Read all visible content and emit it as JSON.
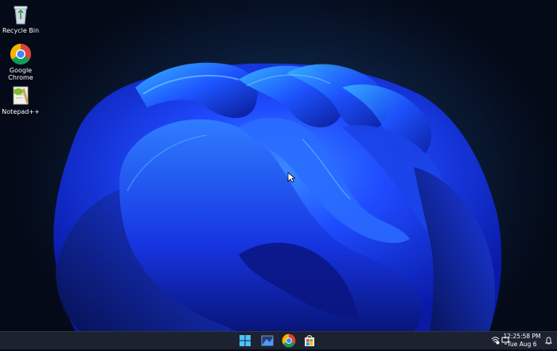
{
  "desktop": {
    "icons": [
      {
        "label": "Recycle Bin",
        "icon": "recycle-bin-icon"
      },
      {
        "label": "Google Chrome",
        "line1": "Google",
        "line2": "Chrome",
        "icon": "chrome-icon"
      },
      {
        "label": "Notepad++",
        "icon": "notepad-plus-plus-icon"
      }
    ]
  },
  "taskbar": {
    "apps": [
      {
        "name": "Start",
        "icon": "windows-start-icon"
      },
      {
        "name": "Task View",
        "icon": "task-view-icon"
      },
      {
        "name": "Google Chrome",
        "icon": "chrome-icon"
      },
      {
        "name": "Microsoft Store",
        "icon": "store-icon"
      }
    ],
    "tray": {
      "time": "12:25:58 PM",
      "date": "Tue Aug 6",
      "icons": [
        "network-icon",
        "display-icon",
        "notification-bell-icon"
      ]
    }
  },
  "colors": {
    "taskbar": "#1d2230",
    "wallpaper_bloom": "#1a3cff",
    "store_red": "#f25022",
    "store_green": "#7fba00",
    "store_blue": "#00a4ef",
    "store_yellow": "#ffb900"
  }
}
